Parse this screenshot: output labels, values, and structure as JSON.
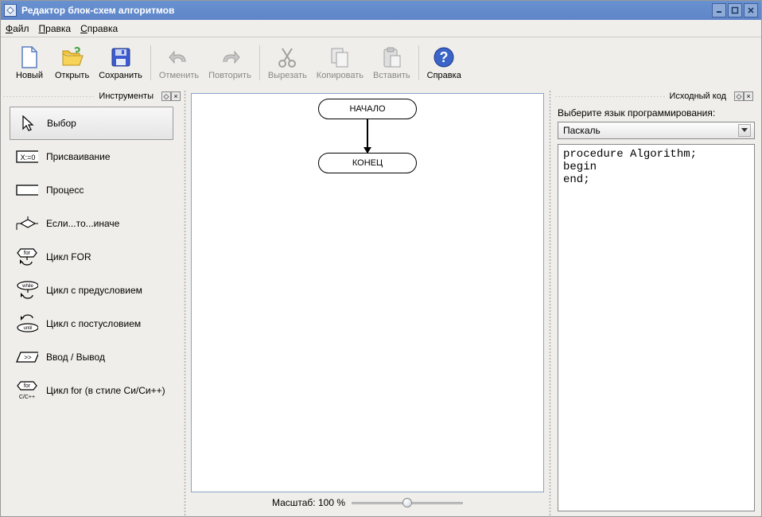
{
  "window": {
    "title": "Редактор блок-схем алгоритмов"
  },
  "menu": {
    "file": "Файл",
    "edit": "Правка",
    "help": "Справка"
  },
  "toolbar": {
    "new": "Новый",
    "open": "Открыть",
    "save": "Сохранить",
    "undo": "Отменить",
    "redo": "Повторить",
    "cut": "Вырезать",
    "copy": "Копировать",
    "paste": "Вставить",
    "help": "Справка"
  },
  "panels": {
    "tools_title": "Инструменты",
    "code_title": "Исходный код"
  },
  "tools": {
    "select": "Выбор",
    "assign": "Присваивание",
    "process": "Процесс",
    "ifelse": "Если...то...иначе",
    "for": "Цикл FOR",
    "while": "Цикл с предусловием",
    "dowhile": "Цикл с постусловием",
    "io": "Ввод / Вывод",
    "cfor": "Цикл for (в стиле Си/Си++)"
  },
  "canvas": {
    "start_label": "НАЧАЛО",
    "end_label": "КОНЕЦ"
  },
  "zoom": {
    "label": "Масштаб: 100 %"
  },
  "code": {
    "lang_prompt": "Выберите язык программирования:",
    "lang_selected": "Паскаль",
    "source": "procedure Algorithm;\nbegin\nend;"
  }
}
